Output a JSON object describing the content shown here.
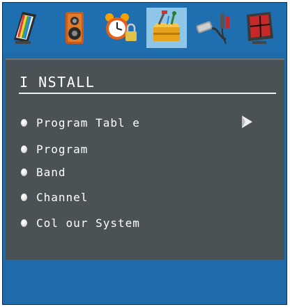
{
  "menu": {
    "title": "I NSTALL",
    "items": [
      {
        "label": "Program Tabl e",
        "highlighted": true
      },
      {
        "label": "Program",
        "highlighted": false
      },
      {
        "label": "Band",
        "highlighted": false
      },
      {
        "label": "Channel",
        "highlighted": false
      },
      {
        "label": "Col our System",
        "highlighted": false
      }
    ]
  },
  "icons": [
    {
      "name": "picture-icon",
      "selected": false
    },
    {
      "name": "sound-speaker-icon",
      "selected": false
    },
    {
      "name": "alarm-clock-lock-icon",
      "selected": false
    },
    {
      "name": "install-toolbox-icon",
      "selected": true
    },
    {
      "name": "source-cables-icon",
      "selected": false
    },
    {
      "name": "pip-monitor-icon",
      "selected": false
    }
  ],
  "colors": {
    "bar": "#1e6eb0",
    "selected_tab": "#8ec6e8",
    "panel": "#4a5256",
    "text": "#ffffff"
  }
}
